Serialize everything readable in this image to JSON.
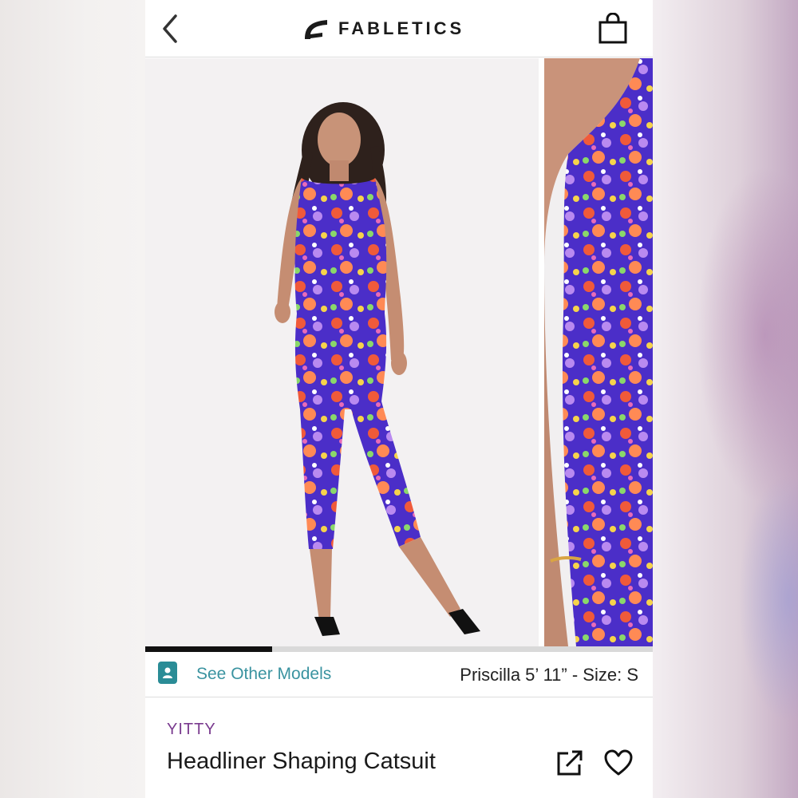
{
  "header": {
    "brand_name": "FABLETICS",
    "back_icon": "chevron-left-icon",
    "bag_icon": "shopping-bag-icon",
    "logo_icon": "fabletics-logo-icon"
  },
  "gallery": {
    "progress_fraction": 0.25,
    "images": [
      "full-body-model-photo",
      "side-detail-photo"
    ]
  },
  "models": {
    "link_label": "See Other Models",
    "icon": "model-portrait-icon",
    "info": "Priscilla 5’ 11” - Size: S"
  },
  "product": {
    "brand": "YITTY",
    "title": "Headliner Shaping Catsuit",
    "share_icon": "share-icon",
    "favorite_icon": "heart-icon"
  },
  "colors": {
    "accent_teal": "#3a93a0",
    "brand_purple": "#7a3b8f",
    "print_purple": "#4a2fc4"
  }
}
